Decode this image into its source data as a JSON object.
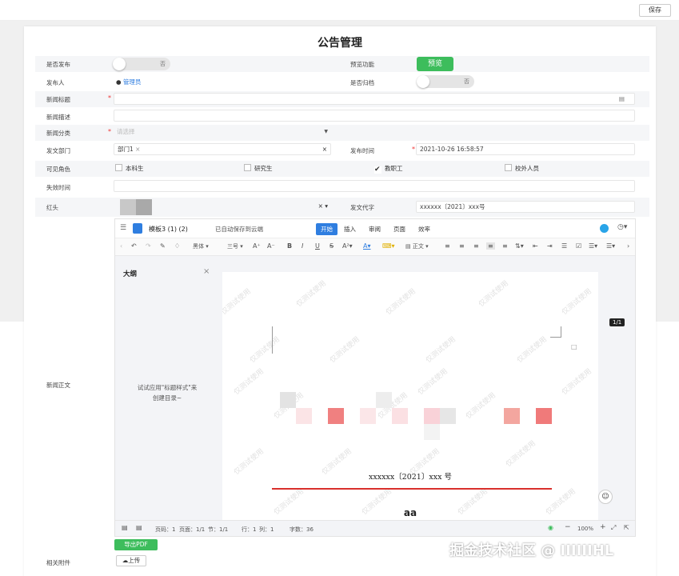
{
  "toolbar": {
    "save_label": "保存"
  },
  "page_title": "公告管理",
  "fields": {
    "publish": {
      "label": "是否发布",
      "toggle_text": "否"
    },
    "preview": {
      "label": "预览功能",
      "button": "预览"
    },
    "publisher": {
      "label": "发布人",
      "value": "管理员"
    },
    "archive": {
      "label": "是否归档",
      "toggle_text": "否"
    },
    "news_title": {
      "label": "新闻标题",
      "required": "*"
    },
    "news_desc": {
      "label": "新闻描述"
    },
    "news_category": {
      "label": "新闻分类",
      "required": "*",
      "placeholder": "请选择"
    },
    "department": {
      "label": "发文部门",
      "tag": "部门1",
      "tag_close": "×",
      "clear": "×"
    },
    "publish_time": {
      "label": "发布时间",
      "required": "*",
      "value": "2021-10-26 16:58:57"
    },
    "visible_roles": {
      "label": "可见角色",
      "options": [
        "本科生",
        "研究生",
        "教职工",
        "校外人员"
      ],
      "checked": [
        false,
        false,
        true,
        false
      ]
    },
    "expire_time": {
      "label": "失效时间"
    },
    "red_header": {
      "label": "红头",
      "clear": "× ▾"
    },
    "doc_code": {
      "label": "发文代字",
      "value": "xxxxxx〔2021〕xxx号"
    },
    "news_body": {
      "label": "新闻正文"
    },
    "attachments": {
      "label": "相关附件"
    }
  },
  "editor": {
    "doc_title": "模板3 (1) (2)",
    "autosave": "已自动保存到云端",
    "tabs": [
      "开始",
      "插入",
      "审阅",
      "页面",
      "效率"
    ],
    "active_tab": "开始",
    "font_name": "黑体",
    "font_size": "三号",
    "style_name": "正文",
    "outline_title": "大纲",
    "outline_close": "×",
    "outline_hint_1": "试试应用\"标题样式\"来",
    "outline_hint_2": "创建目录~",
    "watermark": "仅测试使用",
    "doc_code_line": "xxxxxx〔2021〕xxx 号",
    "body_start": "aa",
    "page_badge": "1/1",
    "status": {
      "page_no": "页码：1",
      "pages": "页面：1/1",
      "section": "节：1/1",
      "row": "行：1",
      "col": "列：1",
      "words": "字数：36",
      "zoom": "100%"
    },
    "accent_color": "#2f7ee0",
    "doc_red_line_color": "#d9302c"
  },
  "buttons": {
    "export_pdf": "导出PDF",
    "upload": "上传"
  },
  "site_watermark": "掘金技术社区 @ IIIIIIHL",
  "colors": {
    "green": "#3dbd5c",
    "red_required": "#e33333",
    "link_blue": "#2f7ee0"
  }
}
